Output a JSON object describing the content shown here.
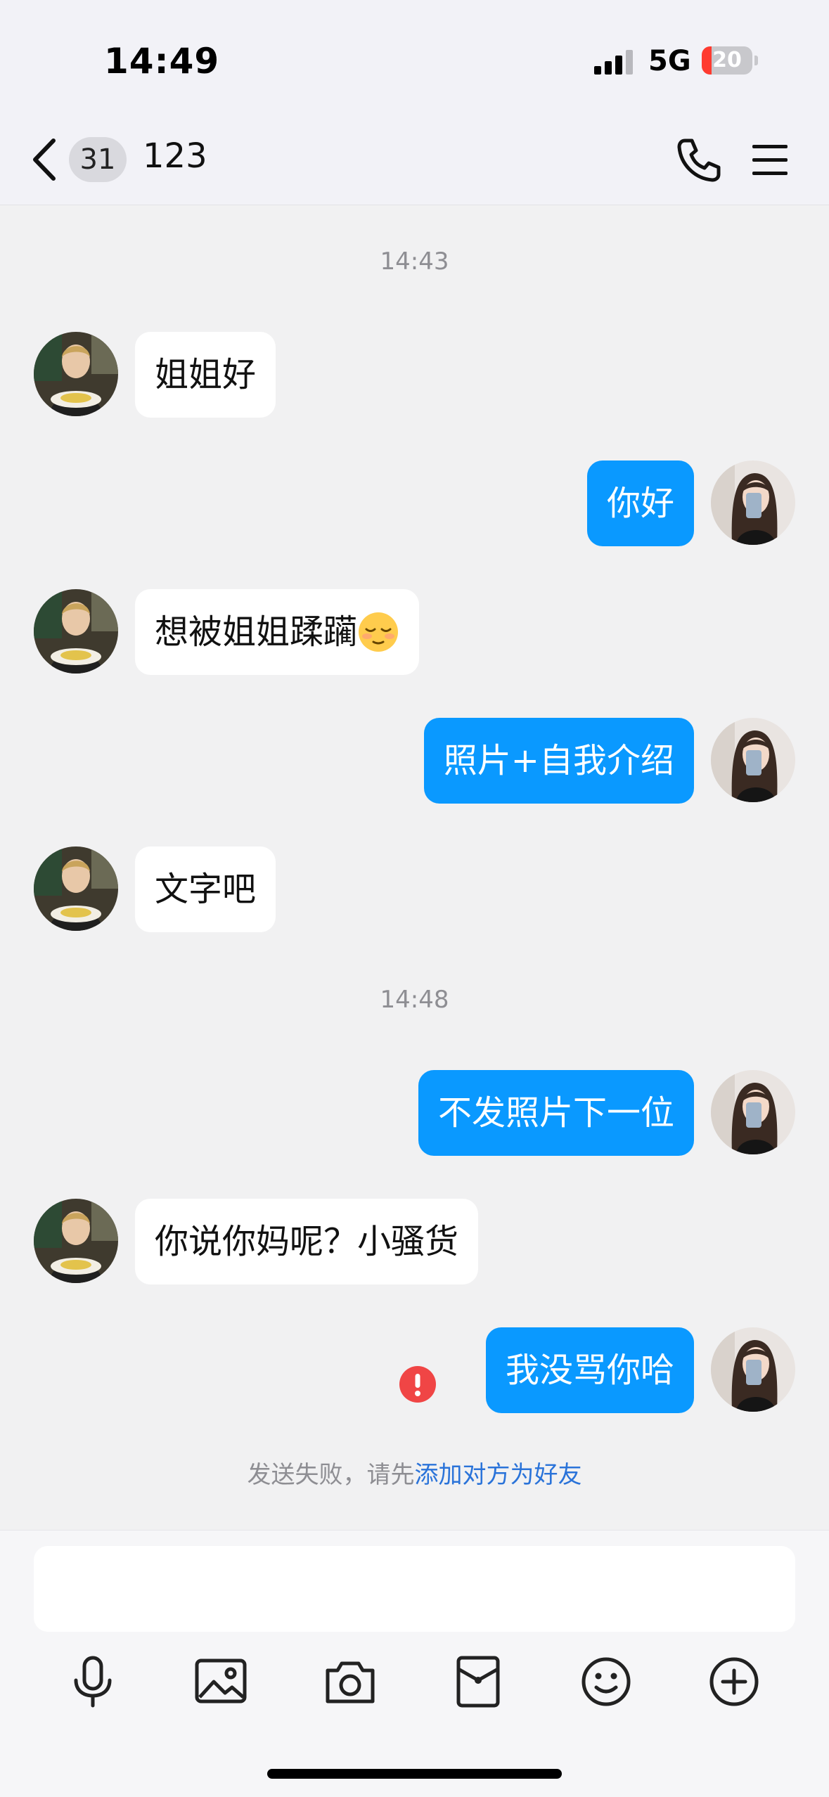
{
  "status_bar": {
    "time": "14:49",
    "network": "5G",
    "battery": 20
  },
  "header": {
    "unread_count": "31",
    "title": "123"
  },
  "messages": [
    {
      "type": "timestamp",
      "text": "14:43"
    },
    {
      "type": "incoming",
      "text": "姐姐好"
    },
    {
      "type": "outgoing",
      "text": "你好"
    },
    {
      "type": "incoming",
      "text": "想被姐姐蹂躏",
      "emoji": "relieved-face"
    },
    {
      "type": "outgoing",
      "text": "照片+自我介绍"
    },
    {
      "type": "incoming",
      "text": "文字吧"
    },
    {
      "type": "timestamp",
      "text": "14:48"
    },
    {
      "type": "outgoing",
      "text": "不发照片下一位"
    },
    {
      "type": "incoming",
      "text": "你说你妈呢？小骚货"
    },
    {
      "type": "outgoing",
      "text": "我没骂你哈",
      "status": "failed"
    }
  ],
  "notice": {
    "prefix": "发送失败，请先",
    "link": "添加对方为好友"
  },
  "input": {
    "placeholder": ""
  },
  "toolbar": [
    "microphone-icon",
    "image-icon",
    "camera-icon",
    "red-packet-icon",
    "emoji-icon",
    "add-icon"
  ],
  "colors": {
    "outgoing_bubble": "#0a99ff",
    "link": "#2a73d9",
    "error": "#f04545"
  }
}
